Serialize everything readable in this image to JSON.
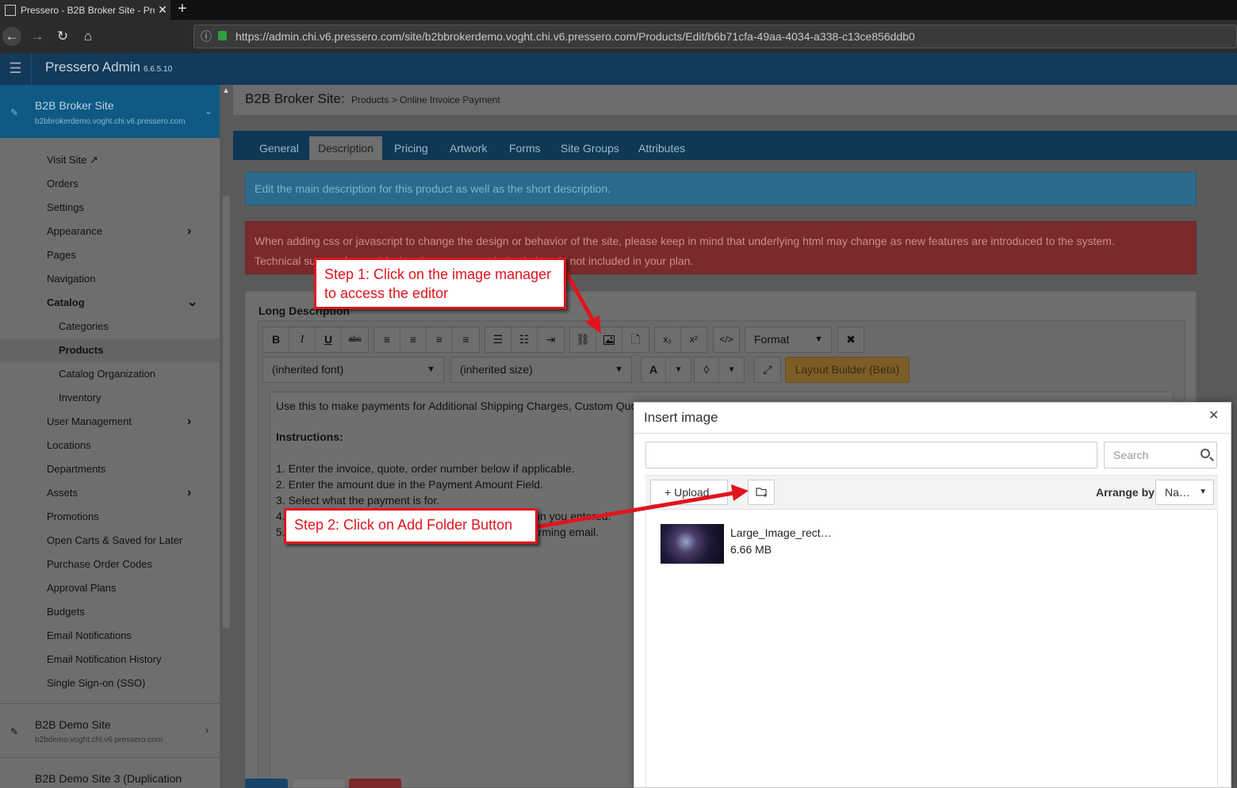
{
  "browser": {
    "tab_title": "Pressero - B2B Broker Site - Pro",
    "tab_close": "✕",
    "new_tab": "+",
    "url": "https://admin.chi.v6.pressero.com/site/b2bbrokerdemo.voght.chi.v6.pressero.com/Products/Edit/b6b71cfa-49aa-4034-a338-c13ce856ddb0"
  },
  "app": {
    "title": "Pressero Admin",
    "version": "6.6.5.10"
  },
  "sidebar": {
    "current_site": {
      "name": "B2B Broker Site",
      "host": "b2bbrokerdemo.voght.chi.v6.pressero.com"
    },
    "items": [
      {
        "label": "Visit Site ↗"
      },
      {
        "label": "Orders"
      },
      {
        "label": "Settings"
      },
      {
        "label": "Appearance"
      },
      {
        "label": "Pages"
      },
      {
        "label": "Navigation"
      },
      {
        "label": "Catalog"
      },
      {
        "label": "Categories"
      },
      {
        "label": "Products"
      },
      {
        "label": "Catalog Organization"
      },
      {
        "label": "Inventory"
      },
      {
        "label": "User Management"
      },
      {
        "label": "Locations"
      },
      {
        "label": "Departments"
      },
      {
        "label": "Assets"
      },
      {
        "label": "Promotions"
      },
      {
        "label": "Open Carts & Saved for Later"
      },
      {
        "label": "Purchase Order Codes"
      },
      {
        "label": "Approval Plans"
      },
      {
        "label": "Budgets"
      },
      {
        "label": "Email Notifications"
      },
      {
        "label": "Email Notification History"
      },
      {
        "label": "Single Sign-on (SSO)"
      }
    ],
    "other_sites": [
      {
        "name": "B2B Demo Site",
        "host": "b2bdemo.voght.chi.v6.pressero.com"
      },
      {
        "name": "B2B Demo Site 3 (Duplication",
        "host": ""
      }
    ]
  },
  "page": {
    "heading": "B2B Broker Site:",
    "breadcrumb": "Products > Online Invoice Payment",
    "tabs": [
      "General",
      "Description",
      "Pricing",
      "Artwork",
      "Forms",
      "Site Groups",
      "Attributes"
    ],
    "info_text": "Edit the main description for this product as well as the short description.",
    "warning_line1": "When adding css or javascript to change the design or behavior of the site, please keep in mind that underlying html may change as new features are introduced to the system.",
    "warning_line2": "Technical support for troubleshooting custom-coded solutions is not included in your plan.",
    "long_description_label": "Long Description"
  },
  "editor": {
    "format_label": "Format",
    "font_label": "(inherited font)",
    "size_label": "(inherited size)",
    "layout_builder": "Layout Builder (Beta)",
    "color_a": "A",
    "content": {
      "line1": "Use this to make payments for Additional Shipping Charges, Custom Quote, Order Upgrades, Change to Design, Express Service or Other Charges.",
      "heading": "Instructions:",
      "step1": "1. Enter the invoice, quote, order number below if applicable.",
      "step2": "2. Enter the amount due in the Payment Amount Field.",
      "step3": "3. Select what the payment is for.",
      "step4": "4. Click Add to Cart and checkout using the information you entered.",
      "step5": "5. Once submitted you will receive a receipt and confirming email."
    }
  },
  "dialog": {
    "title": "Insert image",
    "close": "✕",
    "search_placeholder": "Search",
    "upload_label": "Upload",
    "arrange_label": "Arrange by:",
    "arrange_value": "Na…",
    "file": {
      "name": "Large_Image_rect…",
      "size": "6.66 MB"
    }
  },
  "callouts": {
    "step1_line1": "Step 1: Click on the image manager",
    "step1_line2": "to access the editor",
    "step2": "Step 2: Click on Add Folder Button"
  },
  "colors": {
    "callout_red": "#e1141d",
    "header_blue": "#123a5a",
    "site_blue": "#0e5a85"
  }
}
